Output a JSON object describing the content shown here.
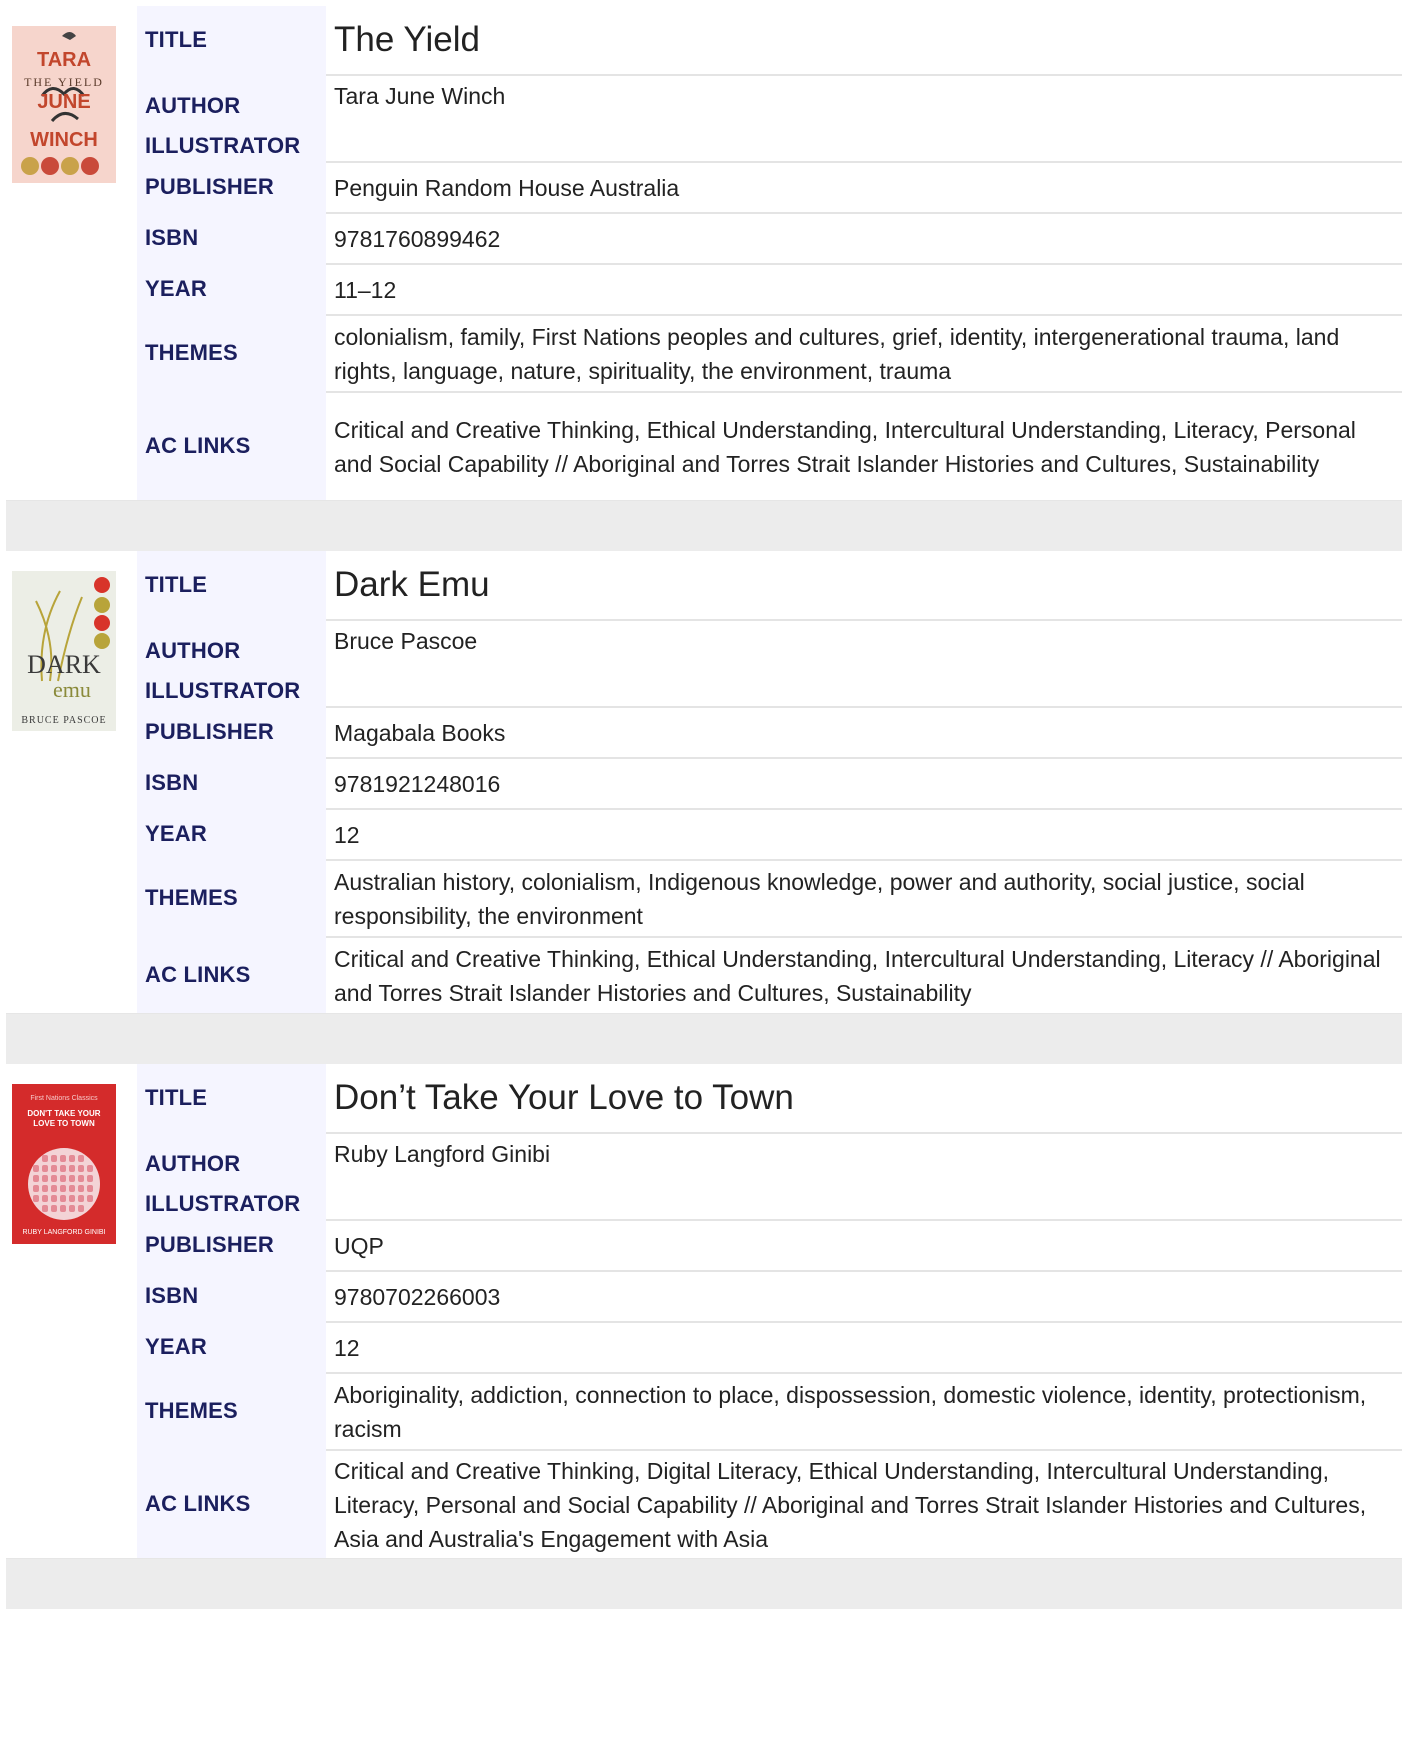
{
  "labels": {
    "title": "TITLE",
    "author": "AUTHOR",
    "illustrator": "ILLUSTRATOR",
    "publisher": "PUBLISHER",
    "isbn": "ISBN",
    "year": "YEAR",
    "themes": "THEMES",
    "ac_links": "AC LINKS"
  },
  "books": [
    {
      "title": "The Yield",
      "author": "Tara June Winch",
      "illustrator": "",
      "publisher": "Penguin Random House Australia",
      "isbn": "9781760899462",
      "year": "11–12",
      "themes": "colonialism, family, First Nations peoples and cultures, grief, identity, intergenerational trauma, land rights, language, nature, spirituality, the environment, trauma",
      "ac_links": "Critical and Creative Thinking, Ethical Understanding, Intercultural Understanding, Literacy, Personal and Social Capability // Aboriginal and Torres Strait Islander Histories and Cultures, Sustainability",
      "cover": {
        "lines": [
          "TARA",
          "THE YIELD",
          "JUNE",
          "WINCH"
        ],
        "bg": "#f6d5cc",
        "fg": "#c2462c"
      }
    },
    {
      "title": "Dark Emu",
      "author": "Bruce Pascoe",
      "illustrator": "",
      "publisher": "Magabala Books",
      "isbn": "9781921248016",
      "year": "12",
      "themes": "Australian history, colonialism, Indigenous knowledge, power and authority, social justice, social responsibility, the environment",
      "ac_links": "Critical and Creative Thinking, Ethical Understanding, Intercultural Understanding, Literacy // Aboriginal and Torres Strait Islander Histories and Cultures, Sustainability",
      "cover": {
        "lines": [
          "DARK",
          "emu",
          "BRUCE PASCOE"
        ],
        "bg": "#eceee6",
        "fg": "#3a3a3a"
      }
    },
    {
      "title": "Don’t Take Your Love to Town",
      "author": "Ruby Langford Ginibi",
      "illustrator": "",
      "publisher": "UQP",
      "isbn": "9780702266003",
      "year": "12",
      "themes": "Aboriginality, addiction, connection to place, dispossession, domestic violence, identity, protectionism, racism",
      "ac_links": "Critical and Creative Thinking, Digital Literacy, Ethical Understanding, Intercultural Understanding, Literacy, Personal and Social Capability // Aboriginal and Torres Strait Islander Histories and Cultures, Asia and Australia's Engagement with Asia",
      "cover": {
        "lines": [
          "First Nations Classics",
          "DON'T TAKE YOUR",
          "LOVE TO TOWN",
          "RUBY LANGFORD GINIBI"
        ],
        "bg": "#d42b2b",
        "fg": "#ffffff"
      }
    }
  ]
}
